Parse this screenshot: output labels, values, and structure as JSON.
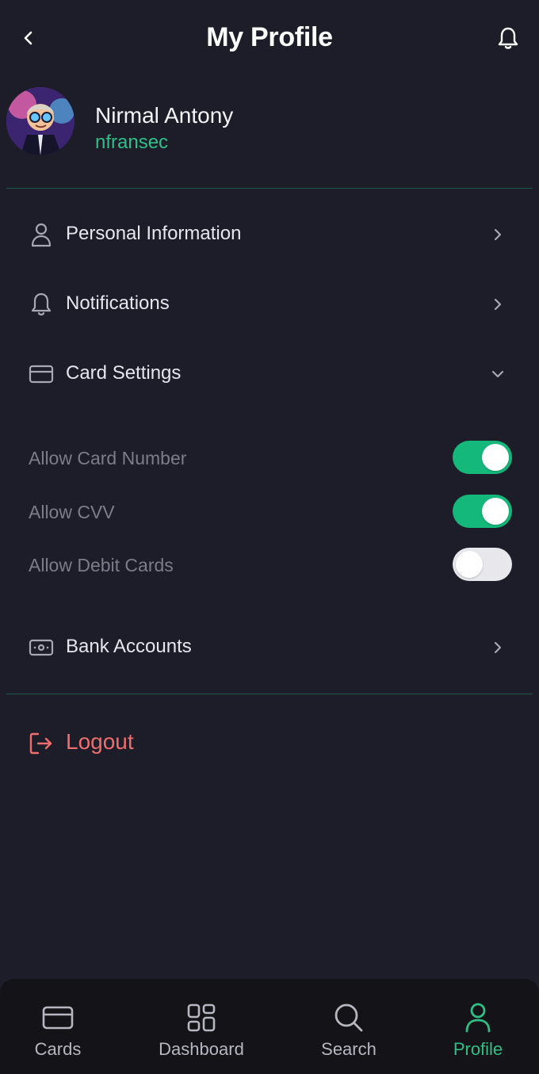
{
  "header": {
    "title": "My Profile",
    "back_icon": "chevron-left-icon",
    "bell_icon": "bell-icon"
  },
  "profile": {
    "name": "Nirmal Antony",
    "handle": "nfransec"
  },
  "menu": {
    "personal_info": "Personal Information",
    "notifications": "Notifications",
    "card_settings": "Card Settings",
    "bank_accounts": "Bank Accounts"
  },
  "card_settings": {
    "toggles": [
      {
        "label": "Allow Card Number",
        "on": true
      },
      {
        "label": "Allow CVV",
        "on": true
      },
      {
        "label": "Allow Debit Cards",
        "on": false
      }
    ]
  },
  "logout": {
    "label": "Logout"
  },
  "nav": {
    "items": [
      {
        "label": "Cards",
        "icon": "card-icon",
        "active": false
      },
      {
        "label": "Dashboard",
        "icon": "dashboard-icon",
        "active": false
      },
      {
        "label": "Search",
        "icon": "search-icon",
        "active": false
      },
      {
        "label": "Profile",
        "icon": "user-icon",
        "active": true
      }
    ]
  },
  "colors": {
    "background": "#1d1d29",
    "accent": "#2fbf87",
    "toggle_on": "#14b87a",
    "logout": "#f06d6d",
    "nav_background": "#131318"
  }
}
